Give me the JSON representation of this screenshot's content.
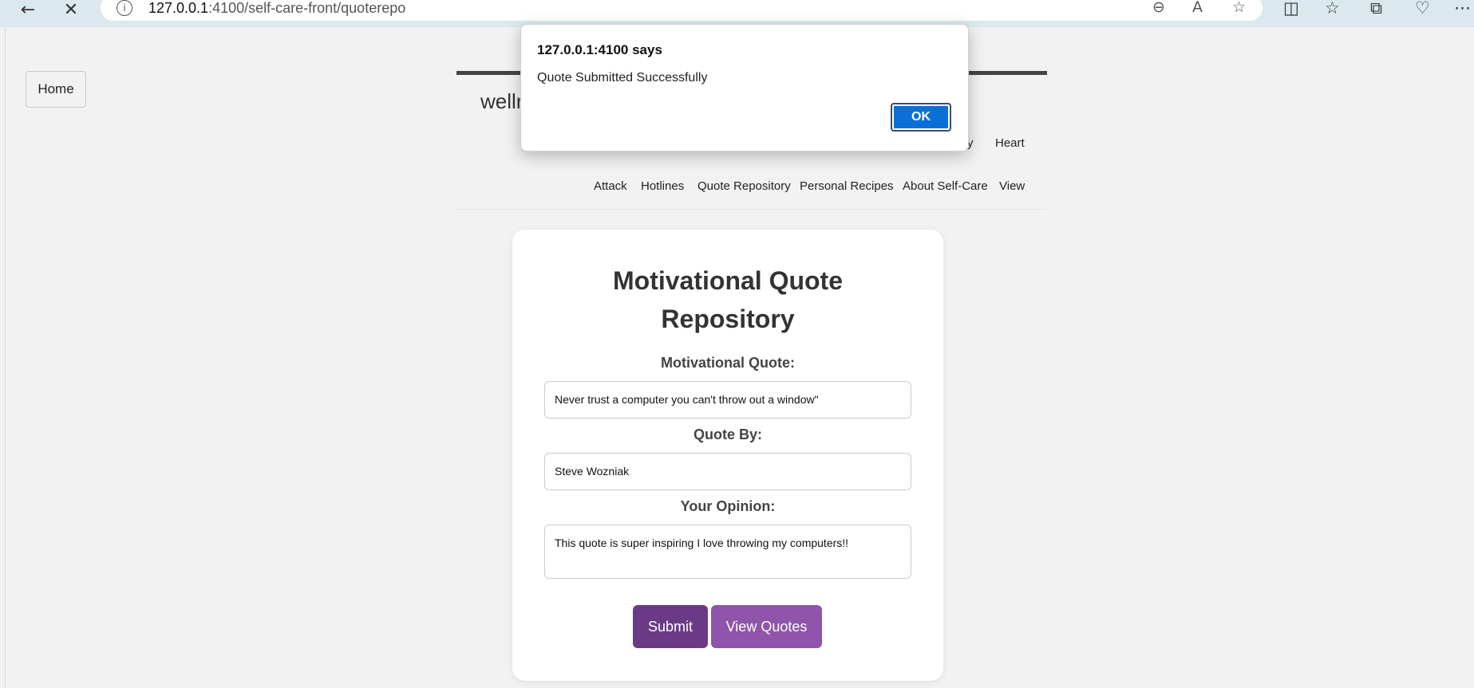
{
  "browser": {
    "url_host": "127.0.0.1",
    "url_rest": ":4100/self-care-front/quoterepo"
  },
  "page": {
    "home_label": "Home",
    "brand_partial": "wellne",
    "nav_row1": [
      "y",
      "Heart"
    ],
    "nav_row2": [
      "Attack",
      "Hotlines",
      "Quote Repository",
      "Personal Recipes",
      "About Self-Care",
      "View"
    ]
  },
  "form": {
    "title_line1": "Motivational Quote",
    "title_line2": "Repository",
    "quote_label": "Motivational Quote:",
    "quote_value": "Never trust a computer you can't throw out a window\"",
    "author_label": "Quote By:",
    "author_value": "Steve Wozniak",
    "opinion_label": "Your Opinion:",
    "opinion_value": "This quote is super inspiring I love throwing my computers!!",
    "submit_label": "Submit",
    "view_label": "View Quotes"
  },
  "dialog": {
    "title": "127.0.0.1:4100 says",
    "message": "Quote Submitted Successfully",
    "ok_label": "OK"
  },
  "colors": {
    "submit": "#6b3a86",
    "view_quotes": "#8e55aa",
    "ok_button": "#0b6fd8"
  }
}
